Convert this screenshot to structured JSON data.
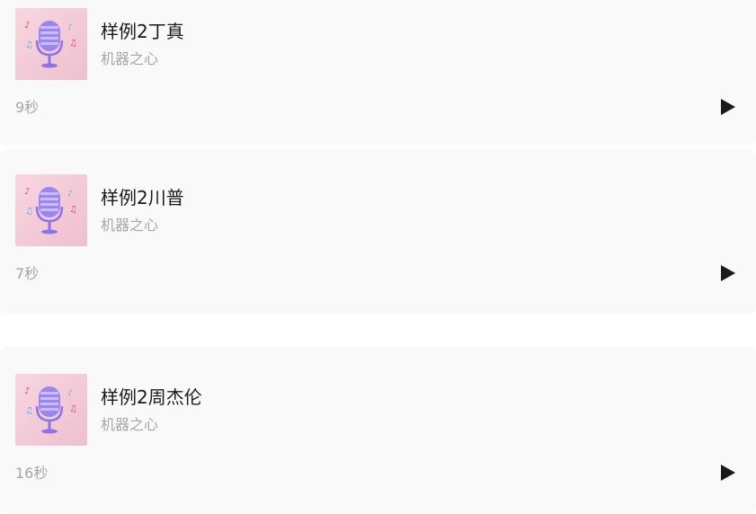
{
  "colors": {
    "card_bg": "#f9f9f9",
    "title": "#1a1a1a",
    "muted": "#a6a6a6",
    "play_icon": "#1a1a1a",
    "cover_bg": "#f2c9d6",
    "mic": "#9b86f0"
  },
  "tracks": [
    {
      "title": "样例2丁真",
      "artist": "机器之心",
      "duration": "9秒",
      "cover_icon": "microphone-icon",
      "play_icon": "play-icon"
    },
    {
      "title": "样例2川普",
      "artist": "机器之心",
      "duration": "7秒",
      "cover_icon": "microphone-icon",
      "play_icon": "play-icon"
    },
    {
      "title": "样例2周杰伦",
      "artist": "机器之心",
      "duration": "16秒",
      "cover_icon": "microphone-icon",
      "play_icon": "play-icon"
    }
  ]
}
